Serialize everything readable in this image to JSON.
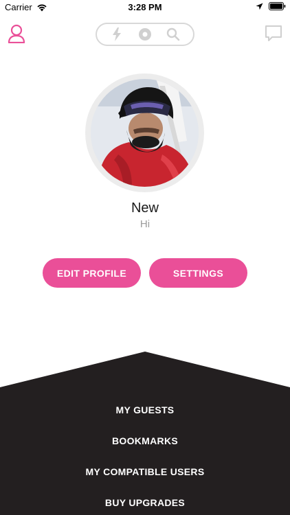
{
  "status_bar": {
    "carrier": "Carrier",
    "time": "3:28 PM"
  },
  "nav": {
    "left_icon": "user-icon",
    "segments": [
      "lightning-icon",
      "record-icon",
      "search-icon"
    ],
    "right_icon": "chat-bubble-icon"
  },
  "profile": {
    "name": "New",
    "status": "Hi"
  },
  "actions": {
    "edit_label": "EDIT PROFILE",
    "settings_label": "SETTINGS"
  },
  "menu": {
    "items": [
      {
        "label": "MY GUESTS"
      },
      {
        "label": "BOOKMARKS"
      },
      {
        "label": "MY COMPATIBLE USERS"
      },
      {
        "label": "BUY UPGRADES"
      }
    ]
  },
  "colors": {
    "accent": "#ea4f98",
    "panel": "#231f20",
    "muted": "#9a9a9a"
  }
}
